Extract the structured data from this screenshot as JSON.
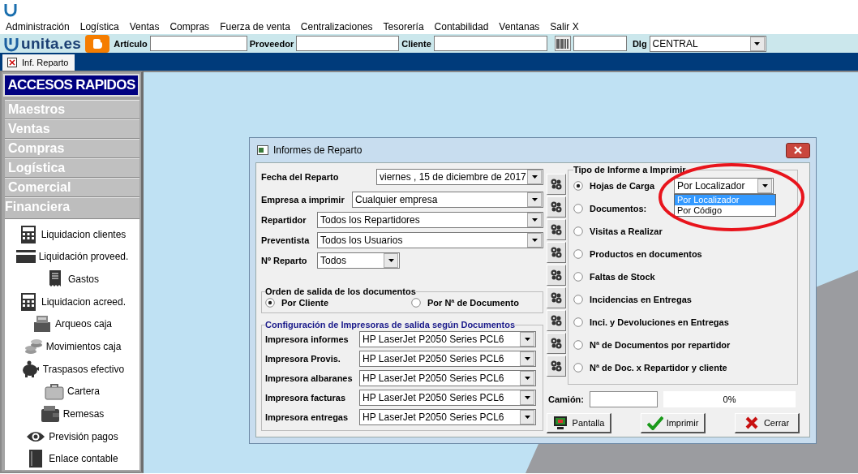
{
  "menu": [
    {
      "label": "Administración"
    },
    {
      "label": "Logística"
    },
    {
      "label": "Ventas"
    },
    {
      "label": "Compras"
    },
    {
      "label": "Fuerza de venta"
    },
    {
      "label": "Centralizaciones"
    },
    {
      "label": "Tesorería"
    },
    {
      "label": "Contabilidad"
    },
    {
      "label": "Ventanas"
    },
    {
      "label": "Salir X"
    }
  ],
  "toolbar": {
    "brand": "unita.es",
    "fields": [
      {
        "label": "Artículo"
      },
      {
        "label": "Proveedor"
      },
      {
        "label": "Cliente"
      }
    ],
    "dlg": {
      "label": "Dlg",
      "value": "CENTRAL"
    }
  },
  "tabs": [
    {
      "label": "Inf. Reparto",
      "selected": true
    }
  ],
  "sidebar": {
    "title": "ACCESOS RAPIDOS",
    "sections": [
      {
        "label": "Maestros",
        "expanded": false
      },
      {
        "label": "Ventas",
        "expanded": false
      },
      {
        "label": "Compras",
        "expanded": false
      },
      {
        "label": "Logística",
        "expanded": false
      },
      {
        "label": "Comercial",
        "expanded": false
      },
      {
        "label": "Financiera",
        "expanded": true,
        "items": [
          {
            "label": "Liquidacion clientes",
            "kind": "calculator"
          },
          {
            "label": "Liquidación proveed.",
            "kind": "card"
          },
          {
            "label": "Gastos",
            "kind": "receipt"
          },
          {
            "label": "Liquidacion acreed.",
            "kind": "calculator"
          },
          {
            "label": "Arqueos caja",
            "kind": "register"
          },
          {
            "label": "Movimientos caja",
            "kind": "coins"
          },
          {
            "label": "Traspasos efectivo",
            "kind": "piggy"
          },
          {
            "label": "Cartera",
            "kind": "briefcase"
          },
          {
            "label": "Remesas",
            "kind": "wallet"
          },
          {
            "label": "Previsión pagos",
            "kind": "eye"
          },
          {
            "label": "Enlace contable",
            "kind": "book"
          }
        ]
      }
    ]
  },
  "dialog": {
    "title": "Informes de Reparto",
    "fields": [
      {
        "label": "Fecha del Reparto",
        "value": "viernes  , 15 de  diciembre  de 2017",
        "kind": "date"
      },
      {
        "label": "Empresa a imprimir",
        "value": "Cualquier empresa",
        "kind": "wide"
      },
      {
        "label": "Repartidor",
        "value": "Todos los Repartidores",
        "kind": "full"
      },
      {
        "label": "Preventista",
        "value": "Todos los Usuarios",
        "kind": "full"
      },
      {
        "label": "Nº Reparto",
        "value": "Todos",
        "kind": "short"
      }
    ],
    "order": {
      "title": "Orden de salida de los documentos",
      "options": [
        {
          "label": "Por Cliente",
          "selected": true
        },
        {
          "label": "Por Nª de Documento",
          "selected": false
        }
      ]
    },
    "printers": {
      "title": "Configuración de Impresoras de salida según Documentos",
      "rows": [
        {
          "label": "Impresora informes",
          "value": "HP LaserJet P2050 Series PCL6"
        },
        {
          "label": "Impresora Provis.",
          "value": "HP LaserJet P2050 Series PCL6"
        },
        {
          "label": "Impresora albaranes",
          "value": "HP LaserJet P2050 Series PCL6"
        },
        {
          "label": "Impresora facturas",
          "value": "HP LaserJet P2050 Series PCL6"
        },
        {
          "label": "Impresora entregas",
          "value": "HP LaserJet P2050 Series PCL6"
        }
      ]
    },
    "report_types": {
      "title": "Tipo de Informe a Imprimir",
      "options": [
        {
          "label": "Hojas de Carga",
          "selected": true,
          "combo": {
            "value": "Por Localizador",
            "expanded": true,
            "list": [
              {
                "label": "Por Localizador",
                "selected": true
              },
              {
                "label": "Por Código",
                "selected": false
              }
            ]
          }
        },
        {
          "label": "Documentos:",
          "selected": false
        },
        {
          "label": "Visitas a Realizar",
          "selected": false
        },
        {
          "label": "Productos en documentos",
          "selected": false
        },
        {
          "label": "Faltas de Stock",
          "selected": false
        },
        {
          "label": "Incidencias en Entregas",
          "selected": false
        },
        {
          "label": "Inci. y Devoluciones en Entregas",
          "selected": false
        },
        {
          "label": "Nª de Documentos por repartidor",
          "selected": false
        },
        {
          "label": "Nª de Doc. x Repartidor y cliente",
          "selected": false
        }
      ]
    },
    "truck": {
      "label": "Camión:"
    },
    "progress": {
      "level": 0,
      "reading": "0%"
    },
    "buttons": [
      {
        "label": "Pantalla",
        "kind": "screen"
      },
      {
        "label": "Imprimir",
        "kind": "print"
      },
      {
        "label": "Cerrar",
        "kind": "close"
      }
    ]
  }
}
